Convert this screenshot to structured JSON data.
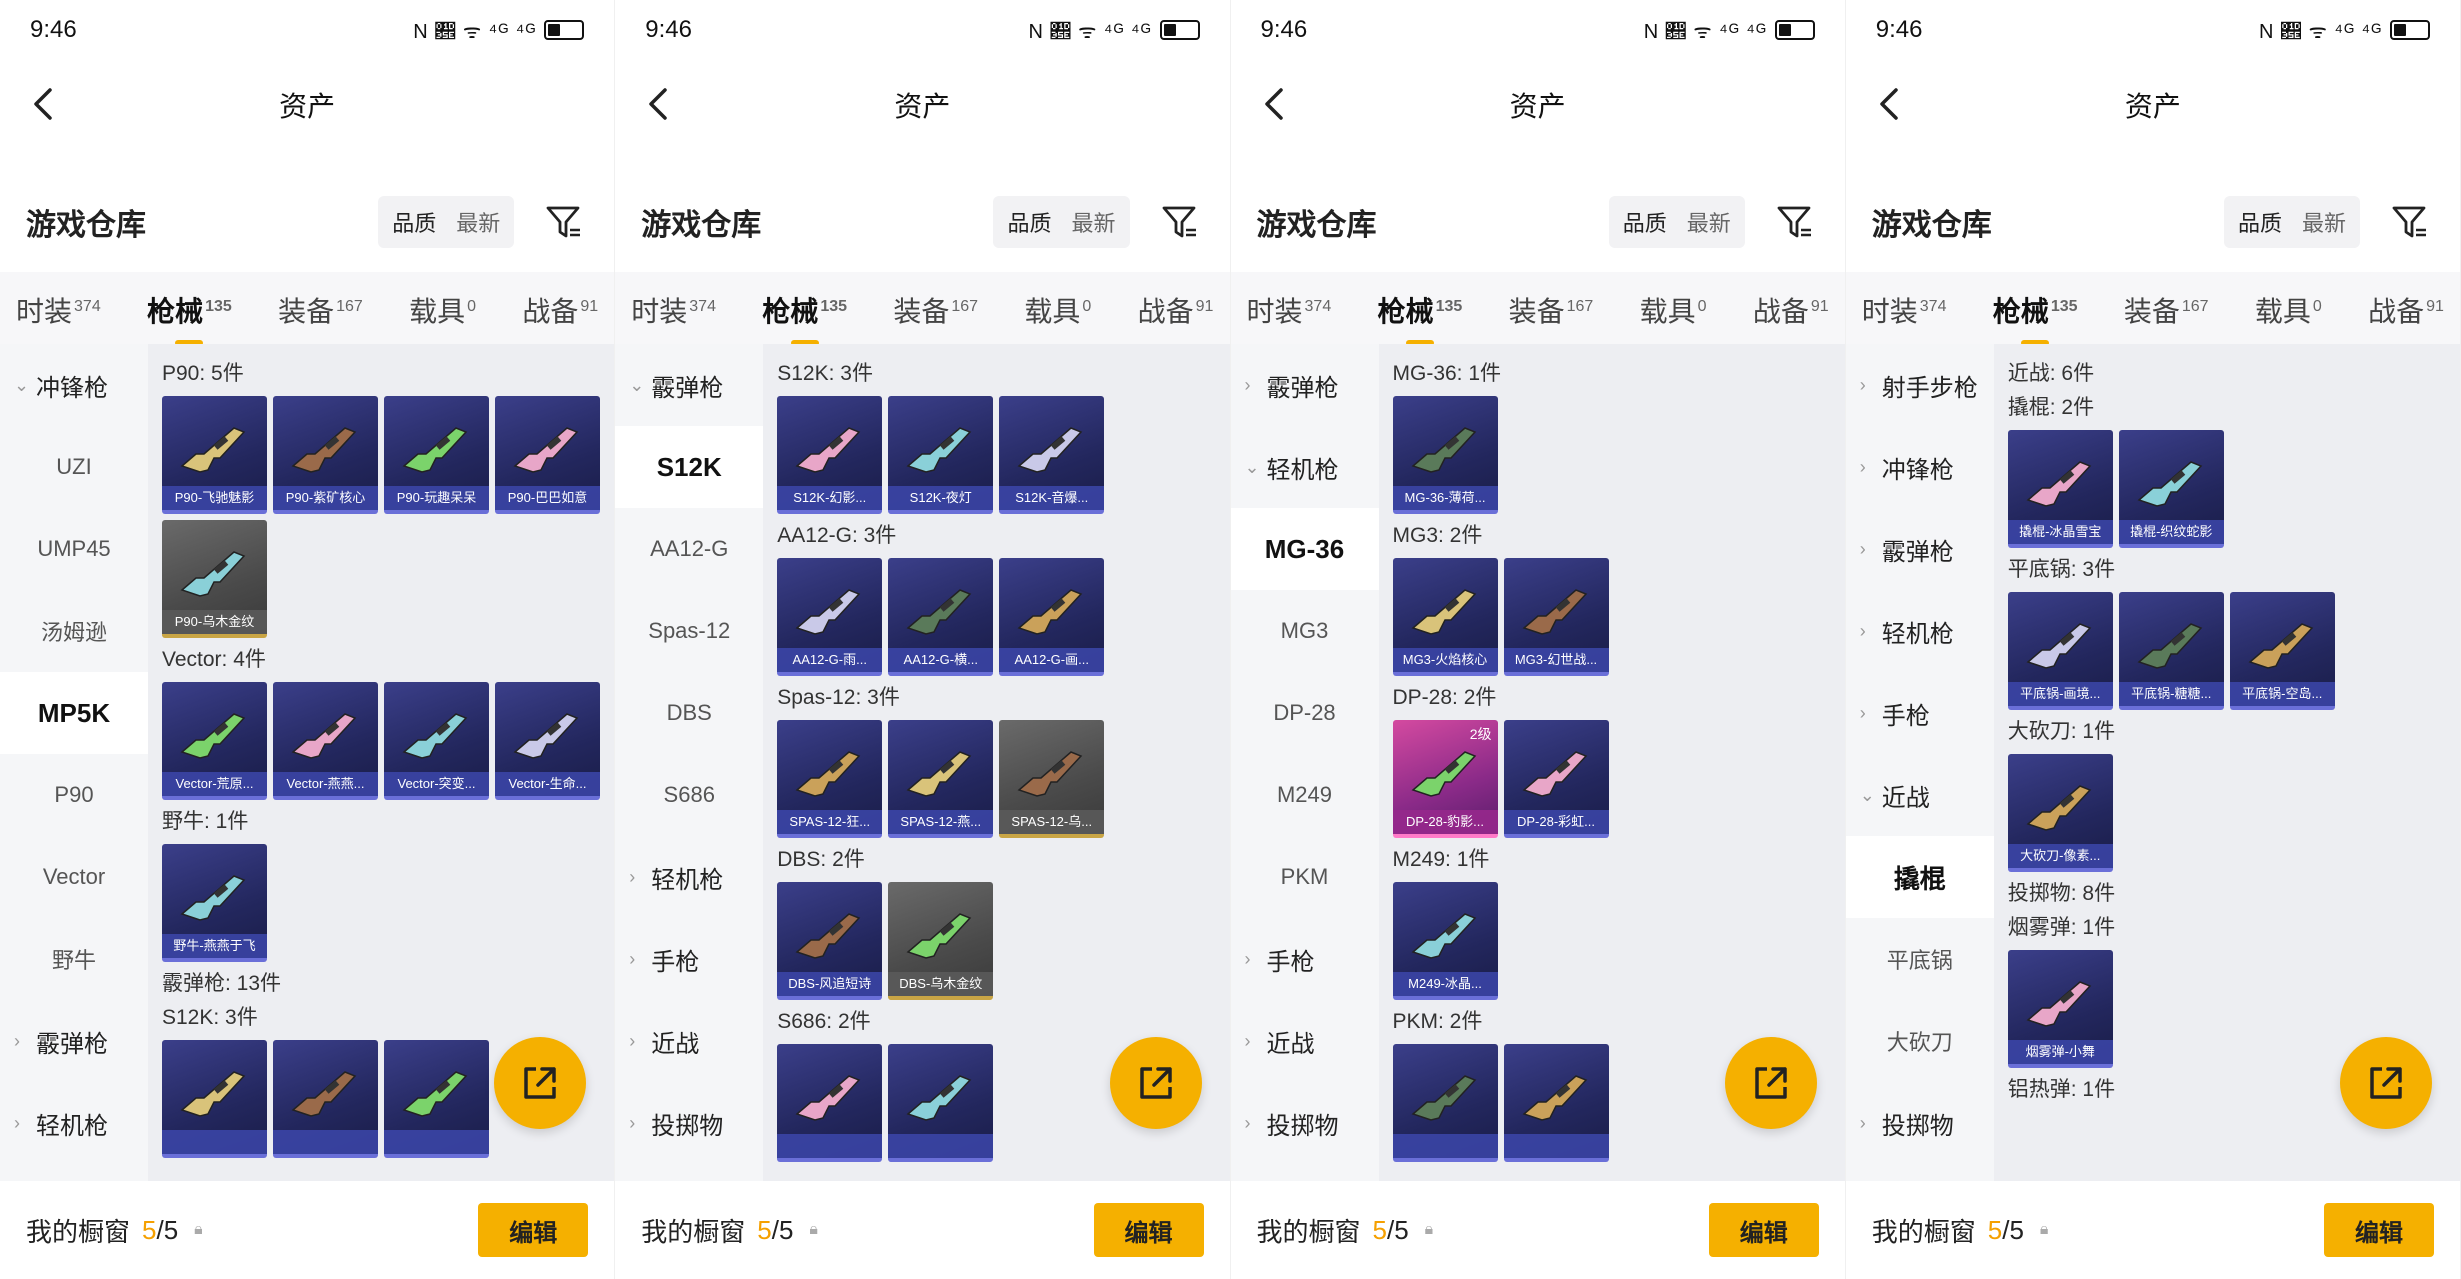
{
  "status": {
    "time": "9:46",
    "icons": "N 𝍞 ᯤ ⁴ᴳ ⁴ᴳ"
  },
  "nav": {
    "title": "资产"
  },
  "warehouse": {
    "title": "游戏仓库",
    "sort_quality": "品质",
    "sort_latest": "最新"
  },
  "tabs": [
    {
      "label": "时装",
      "count": "374"
    },
    {
      "label": "枪械",
      "count": "135"
    },
    {
      "label": "装备",
      "count": "167"
    },
    {
      "label": "载具",
      "count": "0"
    },
    {
      "label": "战备",
      "count": "91"
    }
  ],
  "bottom": {
    "label": "我的橱窗",
    "current": "5",
    "total": "/5",
    "edit": "编辑"
  },
  "panels": [
    {
      "sidebar": [
        {
          "label": "冲锋枪",
          "type": "group",
          "chev": "⌄"
        },
        {
          "label": "UZI",
          "type": "item"
        },
        {
          "label": "UMP45",
          "type": "item"
        },
        {
          "label": "汤姆逊",
          "type": "item"
        },
        {
          "label": "MP5K",
          "type": "active"
        },
        {
          "label": "P90",
          "type": "item"
        },
        {
          "label": "Vector",
          "type": "item"
        },
        {
          "label": "野牛",
          "type": "item"
        },
        {
          "label": "霰弹枪",
          "type": "group",
          "chev": "›"
        },
        {
          "label": "轻机枪",
          "type": "group",
          "chev": "›"
        }
      ],
      "sections": [
        {
          "title": "P90: 5件",
          "items": [
            {
              "name": "P90-飞驰魅影"
            },
            {
              "name": "P90-紫矿核心"
            },
            {
              "name": "P90-玩趣呆呆"
            },
            {
              "name": "P90-巴巴如意"
            },
            {
              "name": "P90-乌木金纹",
              "style": "gold"
            }
          ]
        },
        {
          "title": "Vector: 4件",
          "items": [
            {
              "name": "Vector-荒原..."
            },
            {
              "name": "Vector-燕燕..."
            },
            {
              "name": "Vector-突变..."
            },
            {
              "name": "Vector-生命..."
            }
          ]
        },
        {
          "title": "野牛: 1件",
          "items": [
            {
              "name": "野牛-燕燕于飞"
            }
          ]
        },
        {
          "title": "霰弹枪: 13件",
          "items": []
        },
        {
          "title": "S12K: 3件",
          "items": [
            {
              "name": ""
            },
            {
              "name": ""
            },
            {
              "name": ""
            }
          ]
        }
      ]
    },
    {
      "sidebar": [
        {
          "label": "霰弹枪",
          "type": "group",
          "chev": "⌄"
        },
        {
          "label": "S12K",
          "type": "active"
        },
        {
          "label": "AA12-G",
          "type": "item"
        },
        {
          "label": "Spas-12",
          "type": "item"
        },
        {
          "label": "DBS",
          "type": "item"
        },
        {
          "label": "S686",
          "type": "item"
        },
        {
          "label": "轻机枪",
          "type": "group",
          "chev": "›"
        },
        {
          "label": "手枪",
          "type": "group",
          "chev": "›"
        },
        {
          "label": "近战",
          "type": "group",
          "chev": "›"
        },
        {
          "label": "投掷物",
          "type": "group",
          "chev": "›"
        }
      ],
      "sections": [
        {
          "title": "S12K: 3件",
          "items": [
            {
              "name": "S12K-幻影..."
            },
            {
              "name": "S12K-夜灯"
            },
            {
              "name": "S12K-音爆..."
            }
          ]
        },
        {
          "title": "AA12-G: 3件",
          "items": [
            {
              "name": "AA12-G-雨..."
            },
            {
              "name": "AA12-G-横..."
            },
            {
              "name": "AA12-G-画..."
            }
          ]
        },
        {
          "title": "Spas-12: 3件",
          "items": [
            {
              "name": "SPAS-12-狂..."
            },
            {
              "name": "SPAS-12-燕..."
            },
            {
              "name": "SPAS-12-乌...",
              "style": "gold"
            }
          ]
        },
        {
          "title": "DBS: 2件",
          "items": [
            {
              "name": "DBS-风追短诗"
            },
            {
              "name": "DBS-乌木金纹",
              "style": "gold"
            }
          ]
        },
        {
          "title": "S686: 2件",
          "items": [
            {
              "name": ""
            },
            {
              "name": ""
            }
          ]
        }
      ]
    },
    {
      "sidebar": [
        {
          "label": "霰弹枪",
          "type": "group",
          "chev": "›"
        },
        {
          "label": "轻机枪",
          "type": "group",
          "chev": "⌄"
        },
        {
          "label": "MG-36",
          "type": "active"
        },
        {
          "label": "MG3",
          "type": "item"
        },
        {
          "label": "DP-28",
          "type": "item"
        },
        {
          "label": "M249",
          "type": "item"
        },
        {
          "label": "PKM",
          "type": "item"
        },
        {
          "label": "手枪",
          "type": "group",
          "chev": "›"
        },
        {
          "label": "近战",
          "type": "group",
          "chev": "›"
        },
        {
          "label": "投掷物",
          "type": "group",
          "chev": "›"
        }
      ],
      "sections": [
        {
          "title": "MG-36: 1件",
          "items": [
            {
              "name": "MG-36-薄荷..."
            }
          ]
        },
        {
          "title": "MG3: 2件",
          "items": [
            {
              "name": "MG3-火焰核心"
            },
            {
              "name": "MG3-幻世战..."
            }
          ]
        },
        {
          "title": "DP-28: 2件",
          "items": [
            {
              "name": "DP-28-豹影...",
              "style": "pink",
              "badge": "2级"
            },
            {
              "name": "DP-28-彩虹..."
            }
          ]
        },
        {
          "title": "M249: 1件",
          "items": [
            {
              "name": "M249-冰晶..."
            }
          ]
        },
        {
          "title": "PKM: 2件",
          "items": [
            {
              "name": ""
            },
            {
              "name": ""
            }
          ]
        }
      ]
    },
    {
      "sidebar": [
        {
          "label": "射手步枪",
          "type": "group",
          "chev": "›"
        },
        {
          "label": "冲锋枪",
          "type": "group",
          "chev": "›"
        },
        {
          "label": "霰弹枪",
          "type": "group",
          "chev": "›"
        },
        {
          "label": "轻机枪",
          "type": "group",
          "chev": "›"
        },
        {
          "label": "手枪",
          "type": "group",
          "chev": "›"
        },
        {
          "label": "近战",
          "type": "group",
          "chev": "⌄"
        },
        {
          "label": "撬棍",
          "type": "active"
        },
        {
          "label": "平底锅",
          "type": "item"
        },
        {
          "label": "大砍刀",
          "type": "item"
        },
        {
          "label": "投掷物",
          "type": "group",
          "chev": "›"
        }
      ],
      "sections": [
        {
          "title": "近战: 6件",
          "items": []
        },
        {
          "title": "撬棍: 2件",
          "items": [
            {
              "name": "撬棍-冰晶雪宝"
            },
            {
              "name": "撬棍-织纹蛇影"
            }
          ]
        },
        {
          "title": "平底锅: 3件",
          "items": [
            {
              "name": "平底锅-画境..."
            },
            {
              "name": "平底锅-糖糖..."
            },
            {
              "name": "平底锅-空岛..."
            }
          ]
        },
        {
          "title": "大砍刀: 1件",
          "items": [
            {
              "name": "大砍刀-像素..."
            }
          ]
        },
        {
          "title": "投掷物: 8件",
          "items": []
        },
        {
          "title": "烟雾弹: 1件",
          "items": [
            {
              "name": "烟雾弹-小舞"
            }
          ]
        },
        {
          "title": "铝热弹: 1件",
          "items": []
        }
      ]
    }
  ]
}
